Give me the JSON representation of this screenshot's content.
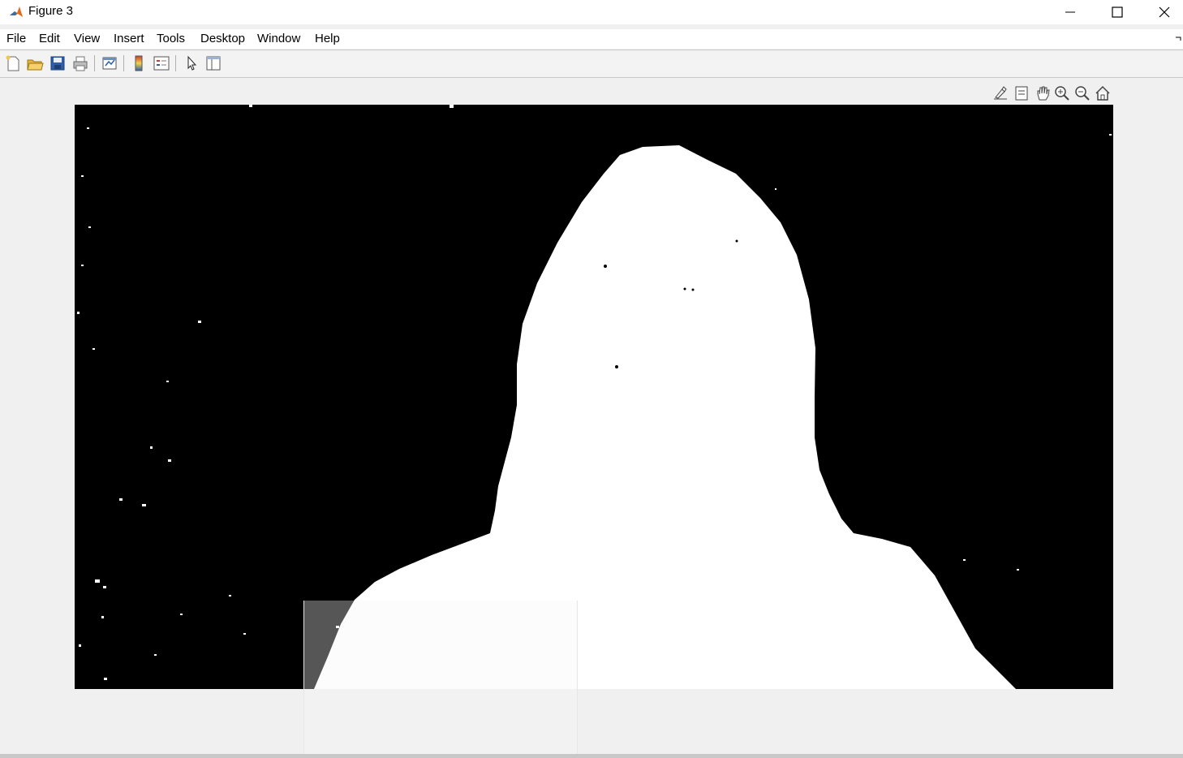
{
  "window": {
    "title": "Figure 3",
    "minimize_icon": "minimize-icon",
    "maximize_icon": "maximize-icon",
    "close_icon": "close-icon"
  },
  "menu": {
    "items": [
      "File",
      "Edit",
      "View",
      "Insert",
      "Tools",
      "Desktop",
      "Window",
      "Help"
    ]
  },
  "toolbar": {
    "buttons": [
      "new-figure-icon",
      "open-file-icon",
      "save-icon",
      "print-icon",
      "link-plot-icon",
      "colorbar-icon",
      "legend-icon",
      "edit-plot-icon",
      "property-inspector-icon"
    ]
  },
  "axes_toolbar": {
    "buttons": [
      "export-icon",
      "data-tip-icon",
      "pan-icon",
      "zoom-in-icon",
      "zoom-out-icon",
      "home-icon"
    ]
  },
  "image": {
    "description_color_bg": "#000000",
    "foreground_color": "#ffffff"
  }
}
